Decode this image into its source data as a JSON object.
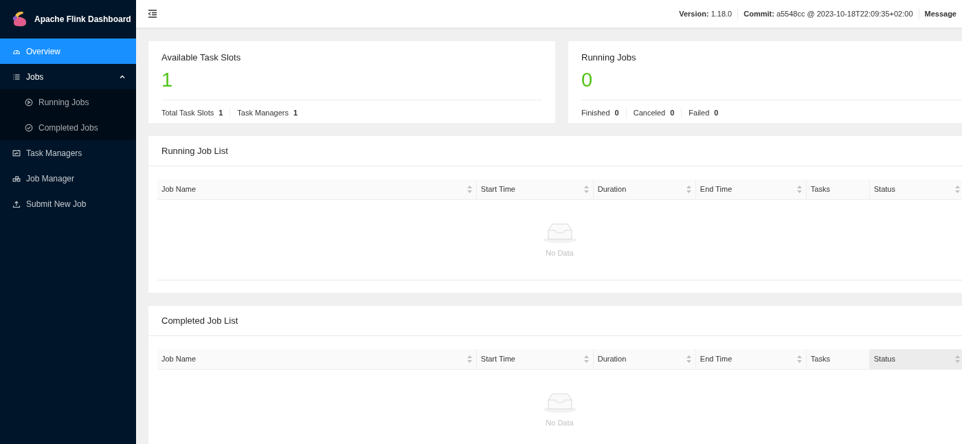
{
  "app": {
    "title": "Apache Flink Dashboard"
  },
  "sidebar": {
    "items": [
      {
        "label": "Overview",
        "selected": true
      },
      {
        "label": "Jobs",
        "selected": false,
        "expanded": true,
        "children": [
          {
            "label": "Running Jobs",
            "selected": false
          },
          {
            "label": "Completed Jobs",
            "selected": false
          }
        ]
      },
      {
        "label": "Task Managers",
        "selected": false
      },
      {
        "label": "Job Manager",
        "selected": false
      },
      {
        "label": "Submit New Job",
        "selected": false
      }
    ]
  },
  "header": {
    "items": [
      {
        "label": "Version:",
        "value": "1.18.0"
      },
      {
        "label": "Commit:",
        "value": "a5548cc @ 2023-10-18T22:09:35+02:00"
      },
      {
        "label": "Message",
        "value": ""
      }
    ]
  },
  "stat_cards": [
    {
      "title": "Available Task Slots",
      "value": "1",
      "stats": [
        {
          "label": "Total Task Slots",
          "value": "1"
        },
        {
          "label": "Task Managers",
          "value": "1"
        }
      ]
    },
    {
      "title": "Running Jobs",
      "value": "0",
      "stats": [
        {
          "label": "Finished",
          "value": "0"
        },
        {
          "label": "Canceled",
          "value": "0"
        },
        {
          "label": "Failed",
          "value": "0"
        }
      ]
    }
  ],
  "job_lists": [
    {
      "title": "Running Job List",
      "empty_text": "No Data",
      "columns": [
        {
          "label": "Job Name",
          "sortable": true,
          "selected": false
        },
        {
          "label": "Start Time",
          "sortable": true,
          "selected": false
        },
        {
          "label": "Duration",
          "sortable": true,
          "selected": false
        },
        {
          "label": "End Time",
          "sortable": true,
          "selected": false
        },
        {
          "label": "Tasks",
          "sortable": false,
          "selected": false
        },
        {
          "label": "Status",
          "sortable": true,
          "selected": false
        }
      ]
    },
    {
      "title": "Completed Job List",
      "empty_text": "No Data",
      "columns": [
        {
          "label": "Job Name",
          "sortable": true,
          "selected": false
        },
        {
          "label": "Start Time",
          "sortable": true,
          "selected": false
        },
        {
          "label": "Duration",
          "sortable": true,
          "selected": false
        },
        {
          "label": "End Time",
          "sortable": true,
          "selected": false
        },
        {
          "label": "Tasks",
          "sortable": false,
          "selected": false
        },
        {
          "label": "Status",
          "sortable": true,
          "selected": true
        }
      ]
    }
  ]
}
